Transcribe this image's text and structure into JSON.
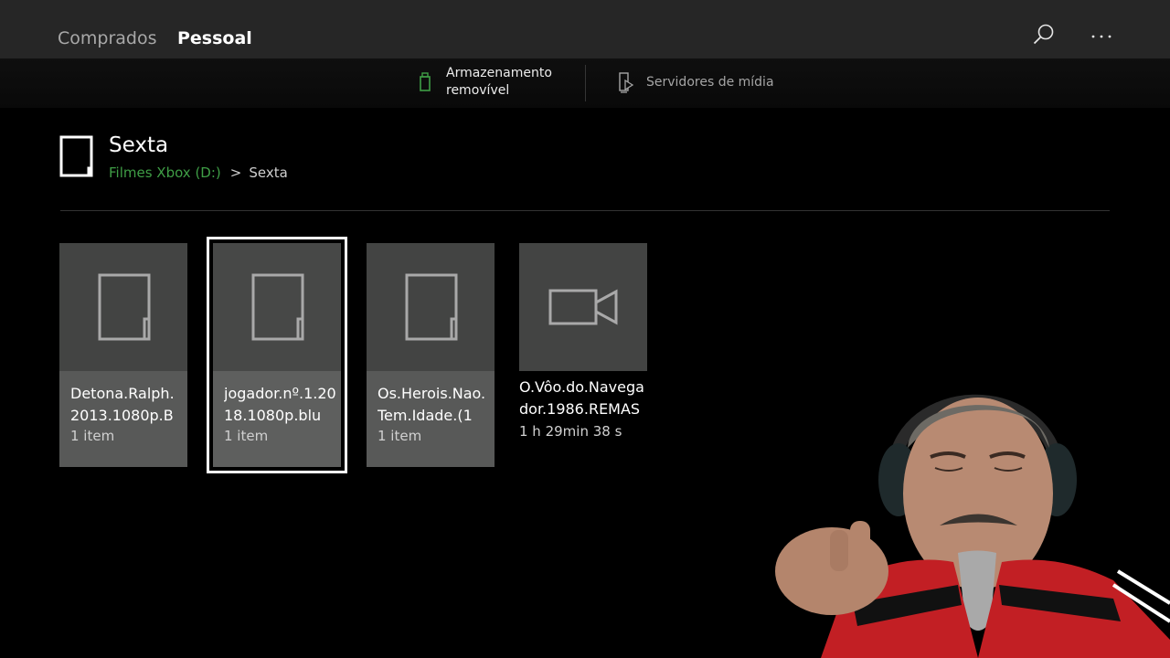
{
  "tabs": [
    {
      "label": "Comprados"
    },
    {
      "label": "Pessoal"
    }
  ],
  "header_icons": [
    "search-icon",
    "more-icon"
  ],
  "subnav": {
    "storage_label": "Armazenamento removível",
    "media_label": "Servidores de mídia"
  },
  "page": {
    "title": "Sexta",
    "breadcrumb": {
      "drive": "Filmes Xbox (D:)",
      "separator": ">",
      "current": "Sexta"
    }
  },
  "items": [
    {
      "name": "Detona.Ralph.2013.1080p.B",
      "meta": "1 item",
      "type": "folder",
      "icon": "folder-icon"
    },
    {
      "name": "jogador.nº.1.2018.1080p.blu",
      "meta": "1 item",
      "type": "folder",
      "icon": "folder-icon",
      "selected": true
    },
    {
      "name": "Os.Herois.Nao.Tem.Idade.(1",
      "meta": "1 item",
      "type": "folder",
      "icon": "folder-icon"
    },
    {
      "name": "O.Vôo.do.Navegador.1986.REMAS",
      "meta": "1 h 29min 38 s",
      "type": "video",
      "icon": "video-camera-icon"
    }
  ],
  "colors": {
    "accent_green": "#3f9e46",
    "topbar": "#262626",
    "tile_body": "#585958",
    "tile_thumb": "#434443"
  }
}
